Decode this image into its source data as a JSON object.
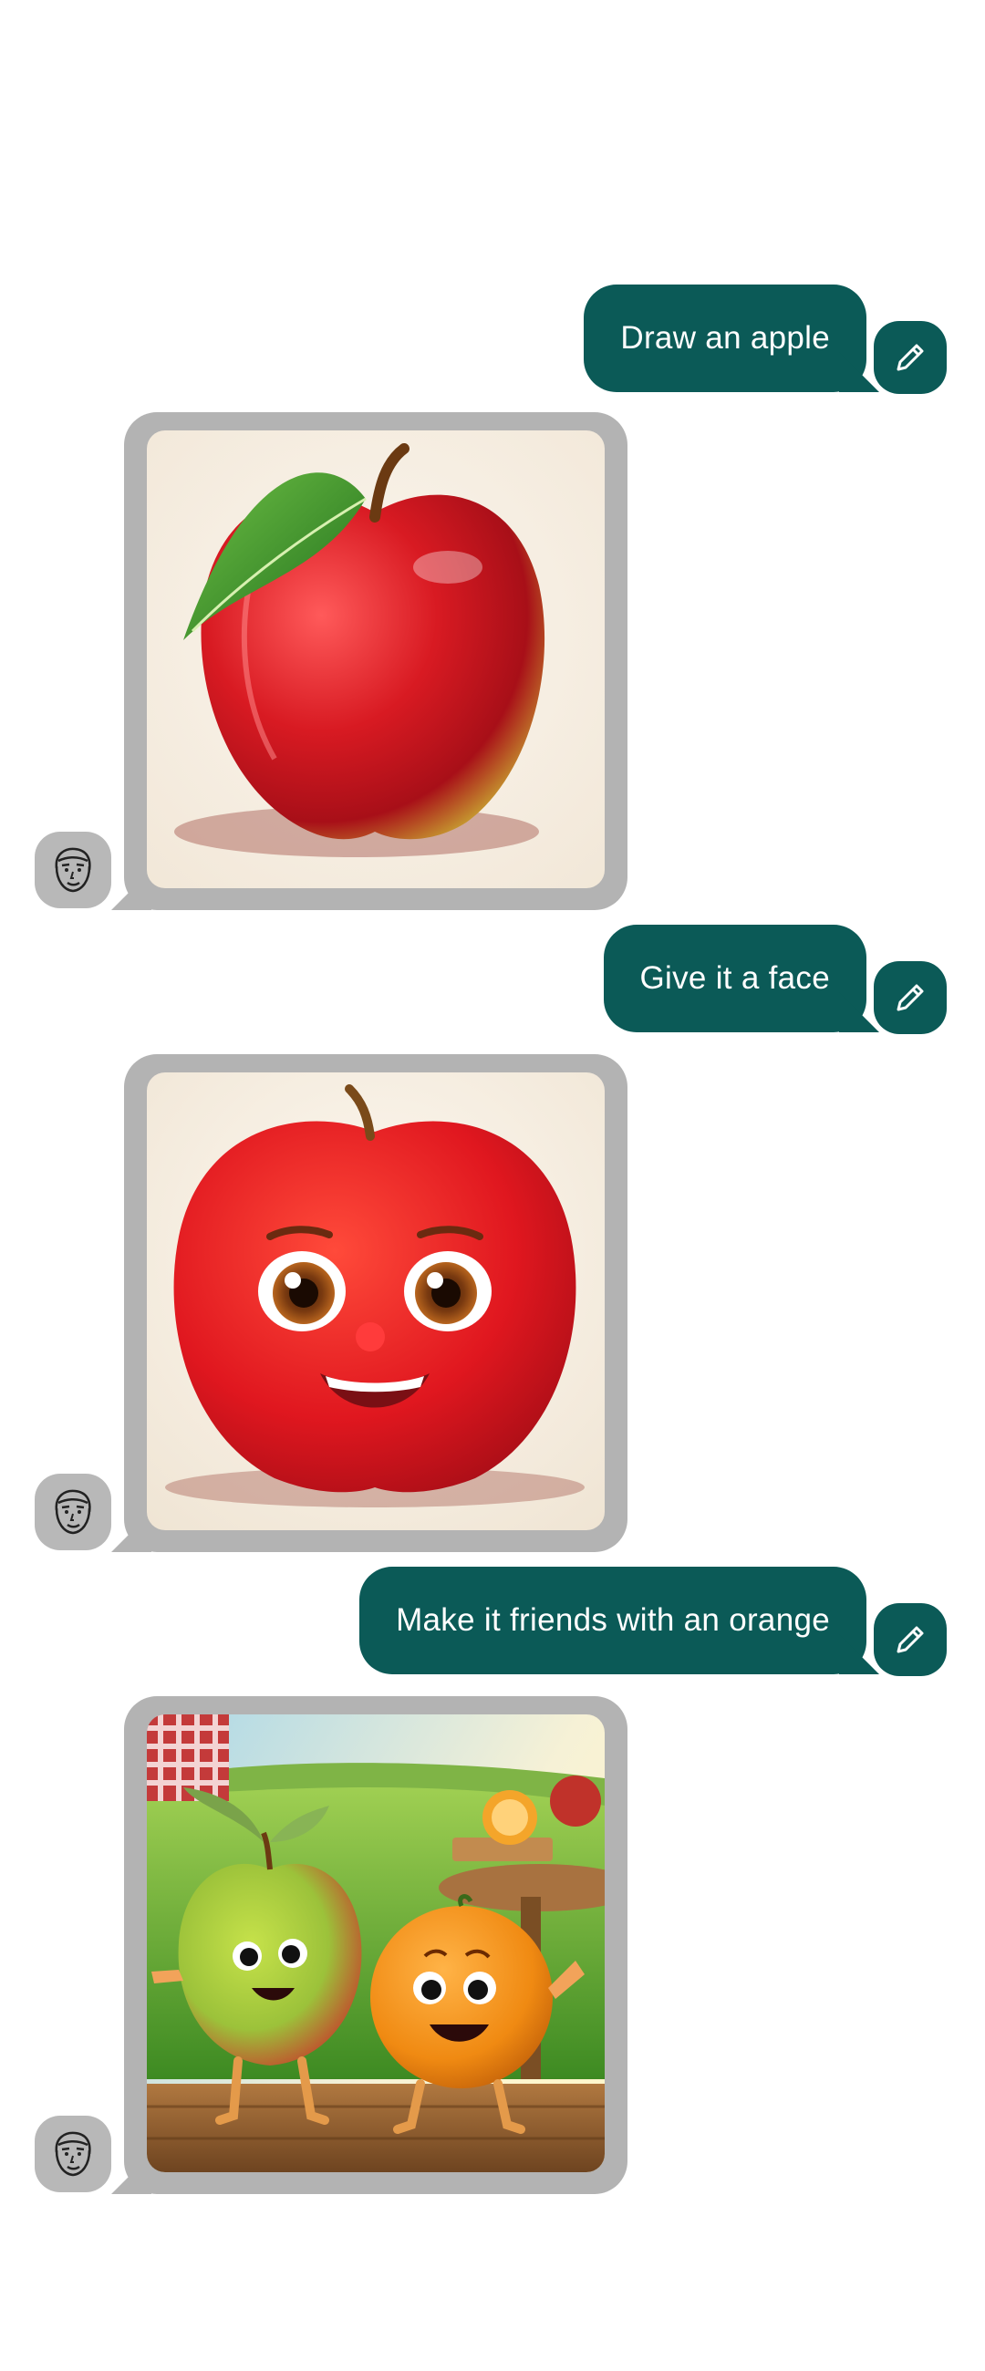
{
  "conversation": {
    "messages": [
      {
        "role": "user",
        "text": "Draw an apple"
      },
      {
        "role": "assistant",
        "image": "red apple with green leaf"
      },
      {
        "role": "user",
        "text": "Give it a face"
      },
      {
        "role": "assistant",
        "image": "cartoon red apple with smiling face"
      },
      {
        "role": "user",
        "text": "Make it friends with an orange"
      },
      {
        "role": "assistant",
        "image": "cartoon apple and orange friends in a field"
      }
    ]
  },
  "icons": {
    "edit": "pencil-icon",
    "assistant_avatar": "face-icon"
  },
  "colors": {
    "user_bubble": "#0b5a57",
    "image_bubble": "#b3b3b3",
    "avatar": "#b8b8b8"
  }
}
